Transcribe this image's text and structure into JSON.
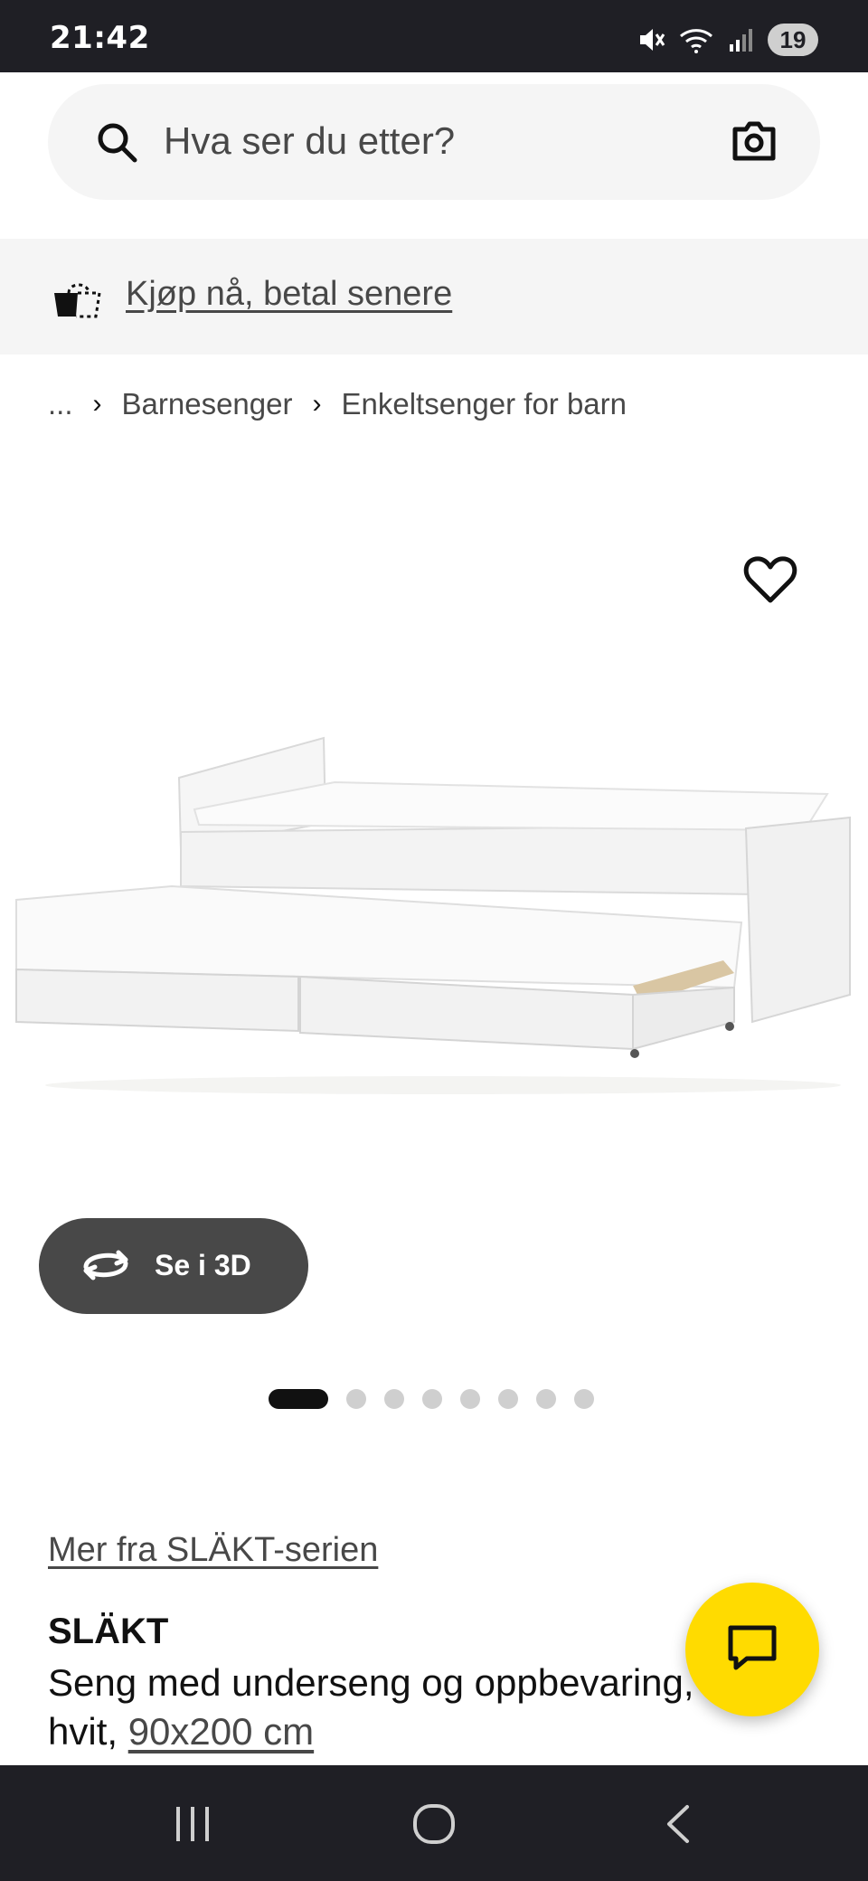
{
  "status_bar": {
    "time": "21:42",
    "battery": "19",
    "icons": [
      "mute-icon",
      "wifi-icon",
      "signal-icon",
      "battery-icon"
    ]
  },
  "search": {
    "placeholder": "Hva ser du etter?",
    "icons": [
      "search-icon",
      "camera-icon"
    ]
  },
  "promo": {
    "label": "Kjøp nå, betal senere",
    "icon": "shopping-bag-icon"
  },
  "breadcrumb": {
    "ellipsis": "...",
    "items": [
      "Barnesenger",
      "Enkeltsenger for barn"
    ]
  },
  "gallery": {
    "view_3d_label": "Se i 3D",
    "page_count": 8,
    "active_index": 0
  },
  "product": {
    "series_link": "Mer fra SLÄKT-serien",
    "name": "SLÄKT",
    "description": "Seng med underseng og oppbevaring,",
    "description_line2": "hvit, ",
    "size": "90x200 cm"
  },
  "colors": {
    "accent_yellow": "#ffdb00",
    "dark": "#111111",
    "chrome": "#1f1f25",
    "muted": "#484848",
    "surface": "#f5f5f5"
  }
}
